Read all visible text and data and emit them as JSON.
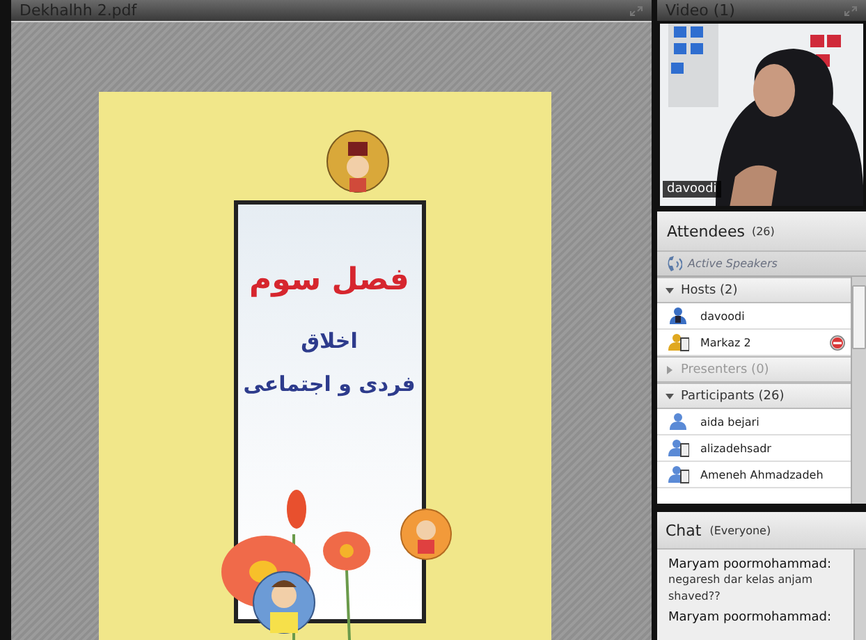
{
  "document": {
    "title": "Dekhalhh 2.pdf",
    "heading": "فصل سوم",
    "subtitle_lines": [
      "اخلاق",
      "فردی و اجتماعی"
    ]
  },
  "video": {
    "title": "Video",
    "count": "(1)",
    "participant_name": "davoodi"
  },
  "attendees": {
    "title": "Attendees",
    "count": "(26)",
    "active_speakers": "Active Speakers",
    "groups": [
      {
        "label": "Hosts (2)",
        "expanded": true,
        "disabled": false,
        "members": [
          {
            "name": "davoodi",
            "kind": "host",
            "status_badge": false
          },
          {
            "name": "Markaz 2",
            "kind": "host-mobile",
            "status_badge": true
          }
        ]
      },
      {
        "label": "Presenters (0)",
        "expanded": false,
        "disabled": true
      },
      {
        "label": "Participants (26)",
        "expanded": true,
        "disabled": false,
        "members": [
          {
            "name": "aida bejari",
            "kind": "user",
            "status_badge": false
          },
          {
            "name": "alizadehsadr",
            "kind": "mobile",
            "status_badge": false
          },
          {
            "name": "Ameneh Ahmadzadeh",
            "kind": "mobile",
            "status_badge": false
          }
        ]
      }
    ]
  },
  "chat": {
    "title": "Chat",
    "scope": "(Everyone)",
    "messages": [
      {
        "sender": "Maryam poormohammad:",
        "text": "negaresh dar kelas anjam shaved??"
      },
      {
        "sender": "Maryam poormohammad:"
      }
    ]
  }
}
